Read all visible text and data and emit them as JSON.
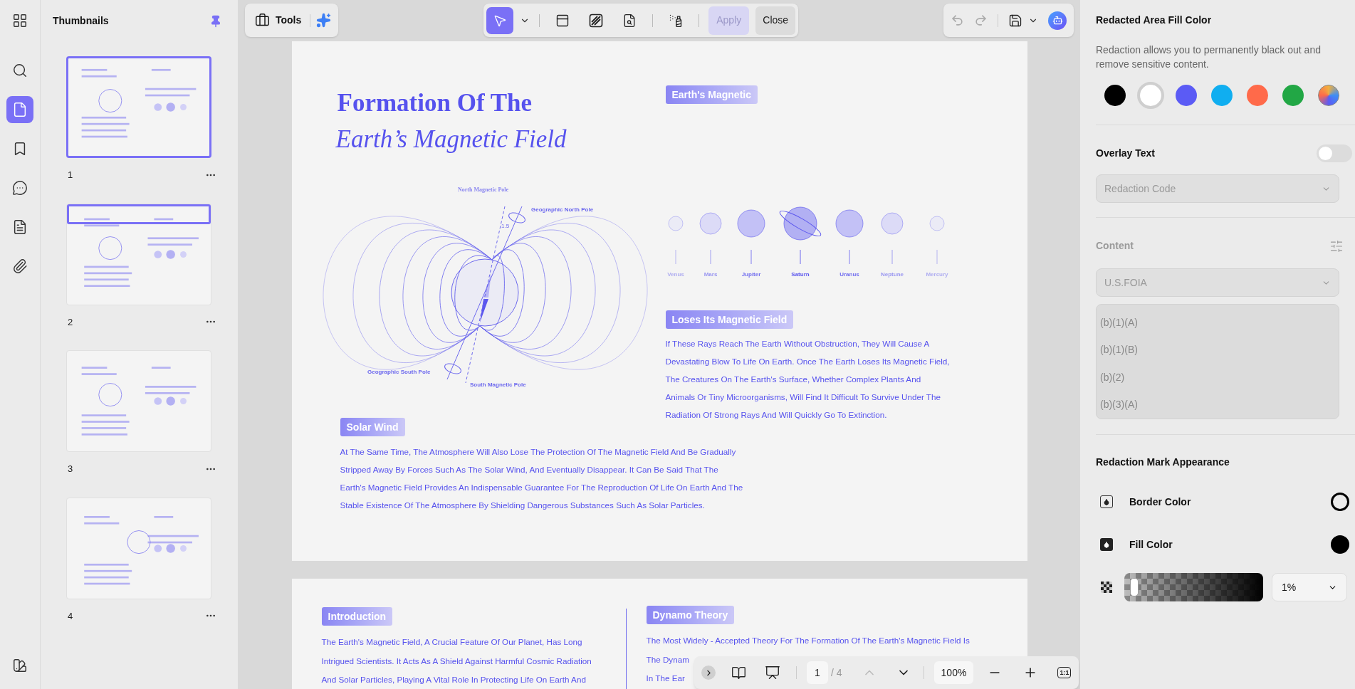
{
  "rail": {
    "items": [
      {
        "kind": "grid",
        "selected": false
      },
      {
        "kind": "search",
        "selected": false
      },
      {
        "kind": "page",
        "selected": true
      },
      {
        "kind": "bookmark",
        "selected": false
      },
      {
        "kind": "comment",
        "selected": false
      },
      {
        "kind": "form",
        "selected": false
      },
      {
        "kind": "attachment",
        "selected": false
      }
    ]
  },
  "thumbnails": {
    "title": "Thumbnails",
    "pinned": true,
    "pages": [
      {
        "number": "1",
        "selected": true,
        "partly_in_view": false
      },
      {
        "number": "2",
        "selected": false,
        "partly_in_view": true
      },
      {
        "number": "3",
        "selected": false,
        "partly_in_view": false
      },
      {
        "number": "4",
        "selected": false,
        "partly_in_view": false
      }
    ]
  },
  "toolbar": {
    "tools_label": "Tools",
    "tools": [
      {
        "kind": "pointer",
        "selected": true
      },
      {
        "kind": "mark-area",
        "selected": false
      },
      {
        "kind": "hatch",
        "selected": false
      },
      {
        "kind": "find",
        "selected": false
      },
      {
        "kind": "erase",
        "selected": false
      }
    ],
    "apply": {
      "label": "Apply",
      "disabled": true
    },
    "close": {
      "label": "Close"
    },
    "undo_disabled": true,
    "redo_disabled": true
  },
  "page1": {
    "title": "Formation Of The",
    "subtitle": "Earth’s Magnetic Field",
    "diagram_labels": {
      "north_magnetic": "North Magnetic Pole",
      "geo_north": "Geographic North Pole",
      "angle": "1.5",
      "geo_south": "Geographic South Pole",
      "south_magnetic": "South Magnetic Pole"
    },
    "tag_1": "Earth's Magnetic",
    "planets": [
      {
        "name": "Venus",
        "kind": "tiny"
      },
      {
        "name": "Mars",
        "kind": "small"
      },
      {
        "name": "Jupiter",
        "kind": "medium"
      },
      {
        "name": "Saturn",
        "kind": "ringed"
      },
      {
        "name": "Uranus",
        "kind": "medium"
      },
      {
        "name": "Neptune",
        "kind": "small"
      },
      {
        "name": "Mercury",
        "kind": "tiny"
      }
    ],
    "tag_2": "Loses Its Magnetic Field",
    "text_2": "If These Rays Reach The Earth Without Obstruction, They Will Cause A Devastating Blow To Life On Earth. Once The Earth Loses Its Magnetic Field, The Creatures On The Earth's Surface, Whether Complex Plants And Animals Or Tiny Microorganisms, Will Find It Difficult To Survive Under The Radiation Of Strong Rays And Will Quickly Go To Extinction.",
    "tag_3": "Solar Wind",
    "text_3": "At The Same Time, The Atmosphere Will Also Lose The Protection Of The Magnetic Field And Be Gradually Stripped Away By Forces Such As The Solar Wind, And Eventually Disappear. It Can Be Said That The Earth's Magnetic Field Provides An Indispensable Guarantee For The Reproduction Of Life On Earth And The Stable Existence Of The Atmosphere By Shielding Dangerous Substances Such As Solar Particles."
  },
  "page2": {
    "tag_1": "Introduction",
    "text_1": "The Earth's Magnetic Field, A Crucial Feature Of Our Planet, Has Long Intrigued Scientists. It Acts As A Shield Against Harmful Cosmic Radiation And Solar Particles, Playing A Vital Role In Protecting Life On Earth And",
    "tag_2": "Dynamo Theory",
    "lines_2": [
      "The Most Widely - Accepted Theory For The Formation Of The Earth's Magnetic Field Is",
      "The Dynam",
      "In The Ear"
    ]
  },
  "nav_bar": {
    "page_value": "1",
    "page_total": "/ 4",
    "zoom": "100%",
    "prev_disabled": true,
    "fit_label": "1:1"
  },
  "panel": {
    "fill_title": "Redacted Area Fill Color",
    "fill_description": "Redaction allows you to permanently black out and remove sensitive content.",
    "fill_colors": [
      {
        "kind": "solid",
        "color": "#000000",
        "selected": false
      },
      {
        "kind": "solid",
        "color": "#ffffff",
        "selected": true
      },
      {
        "kind": "solid",
        "color": "#5b5bf5",
        "selected": false
      },
      {
        "kind": "solid",
        "color": "#10aef0",
        "selected": false
      },
      {
        "kind": "solid",
        "color": "#ff6a4a",
        "selected": false
      },
      {
        "kind": "solid",
        "color": "#22a745",
        "selected": false
      },
      {
        "kind": "custom",
        "selected": false
      }
    ],
    "overlay_title": "Overlay Text",
    "overlay_on": false,
    "overlay_dropdown": {
      "value": "Redaction Code",
      "disabled": true
    },
    "content_title": "Content",
    "content_disabled": true,
    "content_dropdown": {
      "value": "U.S.FOIA",
      "disabled": true
    },
    "content_items": [
      "(b)(1)(A)",
      "(b)(1)(B)",
      "(b)(2)",
      "(b)(3)(A)"
    ],
    "appearance_title": "Redaction Mark Appearance",
    "border_label": "Border Color",
    "fill_label": "Fill Color",
    "opacity": {
      "level": 0.01,
      "value": "1%"
    }
  }
}
